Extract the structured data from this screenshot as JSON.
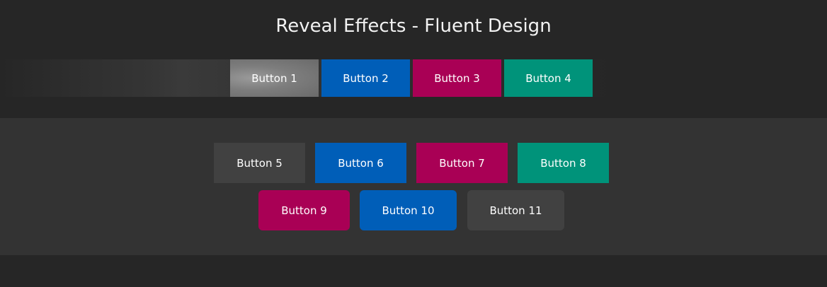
{
  "title": "Reveal Effects - Fluent Design",
  "colors": {
    "background": "#262626",
    "panel": "#333333",
    "gray": "#414141",
    "blue": "#005eb8",
    "magenta": "#a90055",
    "teal": "#00937a"
  },
  "row1": [
    {
      "label": "Button 1",
      "color": "#7d7d7d"
    },
    {
      "label": "Button 2",
      "color": "#005eb8"
    },
    {
      "label": "Button 3",
      "color": "#a90055"
    },
    {
      "label": "Button 4",
      "color": "#00937a"
    }
  ],
  "row2": [
    {
      "label": "Button 5",
      "color": "#414141"
    },
    {
      "label": "Button 6",
      "color": "#005eb8"
    },
    {
      "label": "Button 7",
      "color": "#a90055"
    },
    {
      "label": "Button 8",
      "color": "#00937a"
    }
  ],
  "row3": [
    {
      "label": "Button 9",
      "color": "#a90055"
    },
    {
      "label": "Button 10",
      "color": "#005eb8"
    },
    {
      "label": "Button 11",
      "color": "#414141"
    }
  ]
}
